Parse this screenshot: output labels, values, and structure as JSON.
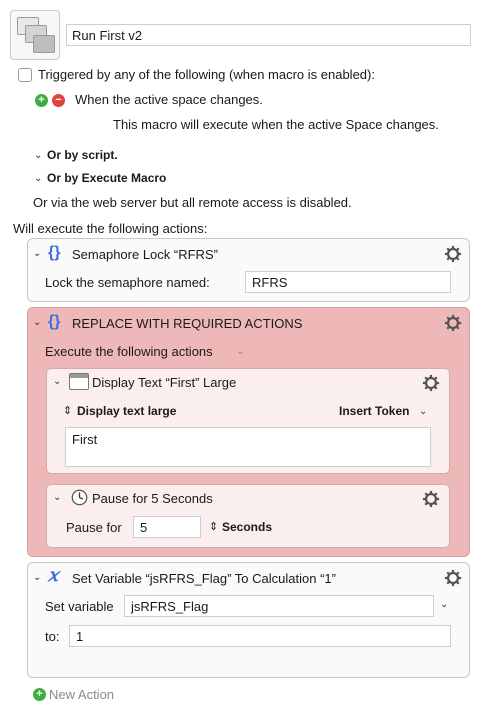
{
  "macro": {
    "name": "Run First v2"
  },
  "triggers": {
    "header": "Triggered by any of the following (when macro is enabled):",
    "trigger_label": "When the active space changes.",
    "trigger_desc": "This macro will execute when the active Space changes.",
    "or_script": "Or by script.",
    "or_execute": "Or by Execute Macro",
    "web_note": "Or via the web server but all remote access is disabled."
  },
  "will_execute": "Will execute the following actions:",
  "actions": {
    "semaphore": {
      "title": "Semaphore Lock “RFRS”",
      "field_label": "Lock the semaphore named:",
      "field_value": "RFRS"
    },
    "group": {
      "title": "REPLACE WITH REQUIRED ACTIONS",
      "execute_label": "Execute the following actions",
      "display": {
        "title": "Display Text “First” Large",
        "mode": "Display text large",
        "insert_token": "Insert Token",
        "text": "First"
      },
      "pause": {
        "title": "Pause for 5 Seconds",
        "label": "Pause for",
        "value": "5",
        "unit": "Seconds"
      }
    },
    "setvar": {
      "title": "Set Variable “jsRFRS_Flag” To Calculation “1”",
      "var_label": "Set variable",
      "var_value": "jsRFRS_Flag",
      "to_label": "to:",
      "to_value": "1"
    }
  },
  "new_action": "New Action",
  "colors": {
    "accent_blue": "#3d6de0",
    "group_pink": "#efb8b8",
    "add_green": "#3fae3f",
    "remove_red": "#e0443a"
  }
}
